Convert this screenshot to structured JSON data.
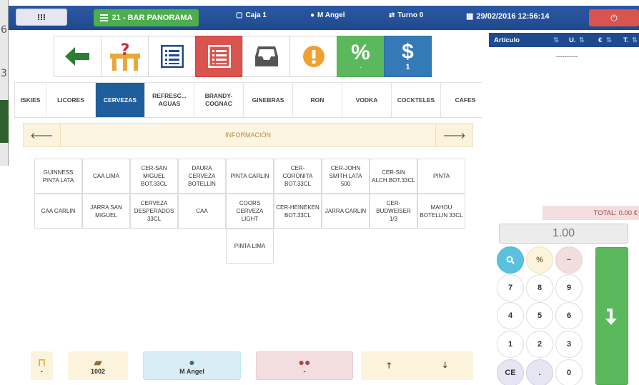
{
  "background_window": {
    "chars": [
      "6",
      "3"
    ]
  },
  "topbar": {
    "table_label": "21 - BAR PANORAMA",
    "register_label": "Caja 1",
    "user_label": "M Angel",
    "shift_label": "Turno 0",
    "datetime_label": "29/02/2016 12:56:14",
    "colors": {
      "bar": "#1f4a8e",
      "table": "#4cae4c",
      "power": "#d9534f"
    }
  },
  "actions": {
    "discount_sub": "-",
    "pay_sub": "1"
  },
  "categories": [
    "ISKIES",
    "LICORES",
    "CERVEZAS",
    "REFRESC... AGUAS",
    "BRANDY-COGNAC",
    "GINEBRAS",
    "RON",
    "VODKA",
    "COCKTELES",
    "CAFES"
  ],
  "active_category": "CERVEZAS",
  "info_label": "INFORMACIÓN",
  "products": [
    "GUINNESS PINTA LATA",
    "CAA LIMA",
    "CER-SAN MIGUEL BOT.33CL",
    "DAURA CERVEZA BOTELLIN",
    "PINTA CARLIN",
    "CER-CORONITA BOT.33CL",
    "CER-JOHN SMITH LATA 500",
    "CER-SIN ALCH.BOT.33CL",
    "PINTA",
    "CAA CARLIN",
    "JARRA SAN MIGUEL",
    "CERVEZA DESPERADOS 33CL",
    "CAA",
    "COORS CERVEZA LIGHT",
    "CER-HEINEKEN BOT.33CL",
    "JARRA CARLIN",
    "CER-BUDWEISER 1/3",
    "MAHOU BOTELLIN 33CL",
    "",
    "",
    "",
    "",
    "PINTA LIMA",
    "",
    "",
    "",
    ""
  ],
  "bottom": {
    "table_value": "-",
    "ticket_value": "1002",
    "user_value": "M Angel",
    "diners_value": "-"
  },
  "order": {
    "col_article": "Artículo",
    "col_units": "U.",
    "col_price": "€",
    "col_total": "T.",
    "dashes": "----------",
    "total_label": "TOTAL: 0.00 €"
  },
  "keypad": {
    "quantity": "1.00",
    "keys": [
      "%",
      "−",
      "7",
      "8",
      "9",
      "4",
      "5",
      "6",
      "1",
      "2",
      "3",
      "CE",
      ".",
      "0"
    ]
  }
}
